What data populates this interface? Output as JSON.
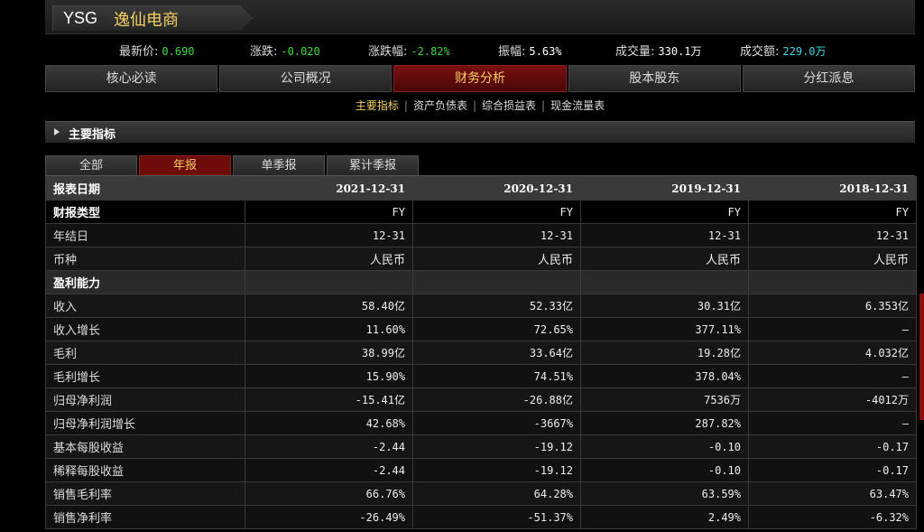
{
  "stock": {
    "code": "YSG",
    "name": "逸仙电商"
  },
  "quote": [
    {
      "label": "最新价:",
      "value": "0.690",
      "color": "#3ddc3d"
    },
    {
      "label": "涨跌:",
      "value": "-0.020",
      "color": "#3ddc3d"
    },
    {
      "label": "涨跌幅:",
      "value": "-2.82%",
      "color": "#3ddc3d"
    },
    {
      "label": "振幅:",
      "value": "5.63%",
      "color": "#ffffff"
    },
    {
      "label": "成交量:",
      "value": "330.1万",
      "color": "#ffffff"
    },
    {
      "label": "成交额:",
      "value": "229.0万",
      "color": "#3dd6e6"
    }
  ],
  "nav": [
    "核心必读",
    "公司概况",
    "财务分析",
    "股本股东",
    "分红派息"
  ],
  "subnav": [
    "主要指标",
    "资产负债表",
    "综合损益表",
    "现金流量表"
  ],
  "section_title": "主要指标",
  "report_tabs": [
    "全部",
    "年报",
    "单季报",
    "累计季报"
  ],
  "table": {
    "header": [
      "报表日期",
      "2021-12-31",
      "2020-12-31",
      "2019-12-31",
      "2018-12-31"
    ],
    "rows": [
      {
        "type": "bold",
        "cells": [
          "财报类型",
          "FY",
          "FY",
          "FY",
          "FY"
        ]
      },
      {
        "type": "row",
        "cells": [
          "年结日",
          "12-31",
          "12-31",
          "12-31",
          "12-31"
        ]
      },
      {
        "type": "row",
        "cells": [
          "币种",
          "人民币",
          "人民币",
          "人民币",
          "人民币"
        ]
      },
      {
        "type": "group",
        "cells": [
          "盈利能力",
          "",
          "",
          "",
          ""
        ]
      },
      {
        "type": "row",
        "cells": [
          "收入",
          "58.40亿",
          "52.33亿",
          "30.31亿",
          "6.353亿"
        ]
      },
      {
        "type": "row",
        "cells": [
          "收入增长",
          "11.60%",
          "72.65%",
          "377.11%",
          "—"
        ]
      },
      {
        "type": "row",
        "cells": [
          "毛利",
          "38.99亿",
          "33.64亿",
          "19.28亿",
          "4.032亿"
        ]
      },
      {
        "type": "row",
        "cells": [
          "毛利增长",
          "15.90%",
          "74.51%",
          "378.04%",
          "—"
        ]
      },
      {
        "type": "row",
        "cells": [
          "归母净利润",
          "-15.41亿",
          "-26.88亿",
          "7536万",
          "-4012万"
        ]
      },
      {
        "type": "row",
        "cells": [
          "归母净利润增长",
          "42.68%",
          "-3667%",
          "287.82%",
          "—"
        ]
      },
      {
        "type": "row",
        "cells": [
          "基本每股收益",
          "-2.44",
          "-19.12",
          "-0.10",
          "-0.17"
        ]
      },
      {
        "type": "row",
        "cells": [
          "稀释每股收益",
          "-2.44",
          "-19.12",
          "-0.10",
          "-0.17"
        ]
      },
      {
        "type": "row",
        "cells": [
          "销售毛利率",
          "66.76%",
          "64.28%",
          "63.59%",
          "63.47%"
        ]
      },
      {
        "type": "row",
        "cells": [
          "销售净利率",
          "-26.49%",
          "-51.37%",
          "2.49%",
          "-6.32%"
        ]
      }
    ]
  }
}
